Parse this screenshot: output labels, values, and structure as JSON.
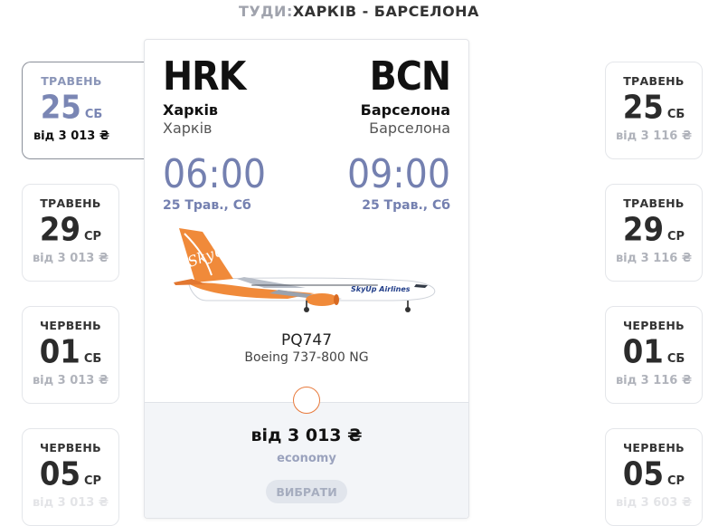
{
  "header": {
    "label": "ТУДИ:",
    "route": "ХАРКІВ - БАРСЕЛОНА"
  },
  "left_dates": [
    {
      "month": "ТРАВЕНЬ",
      "day": "25",
      "weekday": "СБ",
      "price": "від 3 013 ₴"
    },
    {
      "month": "ТРАВЕНЬ",
      "day": "29",
      "weekday": "СР",
      "price": "від 3 013 ₴"
    },
    {
      "month": "ЧЕРВЕНЬ",
      "day": "01",
      "weekday": "СБ",
      "price": "від 3 013 ₴"
    },
    {
      "month": "ЧЕРВЕНЬ",
      "day": "05",
      "weekday": "СР",
      "price": "від 3 013 ₴"
    }
  ],
  "right_dates": [
    {
      "month": "ТРАВЕНЬ",
      "day": "25",
      "weekday": "СБ",
      "price": "від 3 116 ₴"
    },
    {
      "month": "ТРАВЕНЬ",
      "day": "29",
      "weekday": "СР",
      "price": "від 3 116 ₴"
    },
    {
      "month": "ЧЕРВЕНЬ",
      "day": "01",
      "weekday": "СБ",
      "price": "від 3 116 ₴"
    },
    {
      "month": "ЧЕРВЕНЬ",
      "day": "05",
      "weekday": "СР",
      "price": "від 3 603 ₴"
    }
  ],
  "flight": {
    "origin": {
      "code": "HRK",
      "city": "Харків",
      "airport": "Харків",
      "time": "06:00",
      "date": "25 Трав., Сб"
    },
    "destination": {
      "code": "BCN",
      "city": "Барселона",
      "airport": "Барселона",
      "time": "09:00",
      "date": "25 Трав., Сб"
    },
    "number": "PQ747",
    "aircraft": "Boeing 737-800 NG",
    "airline_livery_text": "SkyUp",
    "livery_fuselage_text": "SkyUp Airlines",
    "price": "від 3 013 ₴",
    "fare_class": "economy",
    "select_label": "ВИБРАТИ"
  },
  "colors": {
    "accent_orange": "#e87a3c",
    "time_blue": "#7480b0",
    "muted_gray": "#b0b3bb"
  }
}
